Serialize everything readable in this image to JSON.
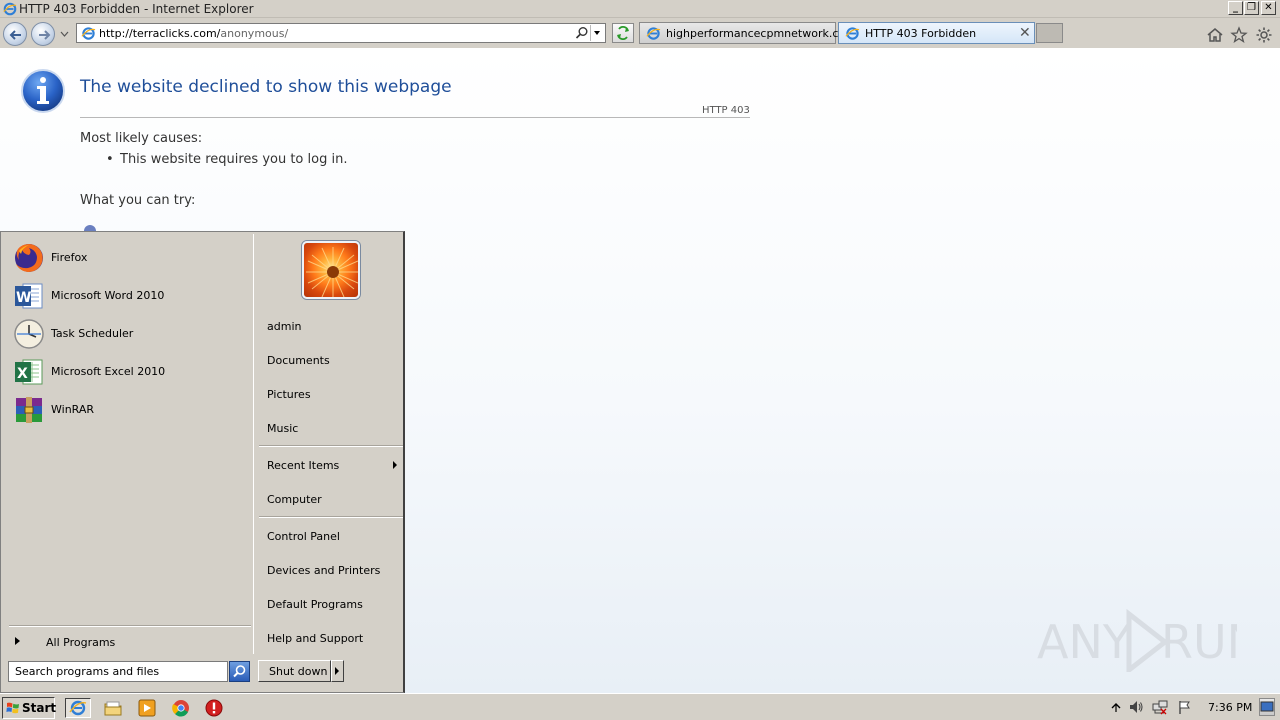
{
  "window": {
    "title": "HTTP 403 Forbidden - Internet Explorer",
    "controls": [
      "_",
      "❐",
      "✕"
    ]
  },
  "navbar": {
    "address_host": "http://terraclicks.com/",
    "address_path": "anonymous/",
    "tabs": [
      {
        "label": "highperformancecpmnetwork.com",
        "active": false
      },
      {
        "label": "HTTP 403 Forbidden",
        "active": true,
        "close": "✕"
      }
    ]
  },
  "page": {
    "title": "The website declined to show this webpage",
    "code": "HTTP 403",
    "causes_heading": "Most likely causes:",
    "bullet": "•",
    "causes": [
      "This website requires you to log in."
    ],
    "try_heading": "What you can try:",
    "accent_color": "#1f4e99"
  },
  "start_menu": {
    "programs": [
      {
        "label": "Firefox",
        "icon": "firefox-icon"
      },
      {
        "label": "Microsoft Word 2010",
        "icon": "word-icon"
      },
      {
        "label": "Task Scheduler",
        "icon": "clock-icon"
      },
      {
        "label": "Microsoft Excel 2010",
        "icon": "excel-icon"
      },
      {
        "label": "WinRAR",
        "icon": "winrar-icon"
      }
    ],
    "all_programs": "All Programs",
    "search_placeholder": "Search programs and files",
    "right_items": {
      "admin": "admin",
      "documents": "Documents",
      "pictures": "Pictures",
      "music": "Music",
      "recent": "Recent Items",
      "computer": "Computer",
      "control_panel": "Control Panel",
      "devices": "Devices and Printers",
      "defaults": "Default Programs",
      "help": "Help and Support"
    },
    "shutdown": "Shut down"
  },
  "taskbar": {
    "start": "Start",
    "clock": "7:36 PM"
  },
  "watermark": "ANY.RUN"
}
